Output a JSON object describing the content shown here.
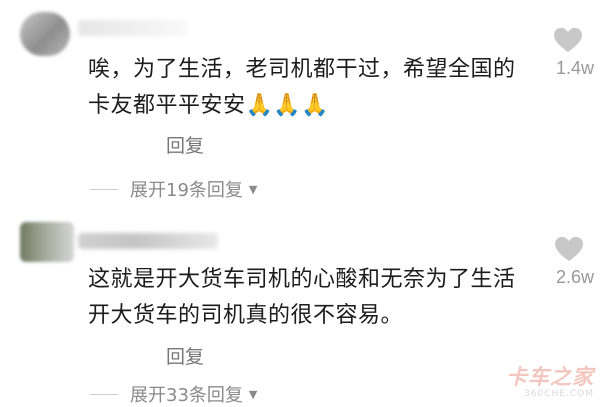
{
  "comments": [
    {
      "text": "唉，为了生活，老司机都干过，希望全国的\n卡友都平平安安🙏🙏🙏",
      "like_count": "1.4w",
      "reply_label": "回复",
      "expand_label": "展开19条回复"
    },
    {
      "text": "这就是开大货车司机的心酸和无奈为了生活\n开大货车的司机真的很不容易。",
      "like_count": "2.6w",
      "reply_label": "回复",
      "expand_label": "展开33条回复"
    }
  ],
  "icons": {
    "like": "heart-icon",
    "expand": "caret-down-icon"
  },
  "colors": {
    "like_icon": "#c8c8c8",
    "meta_text": "#8a8a8a",
    "watermark": "#f3c7bf"
  },
  "watermark": {
    "main": "卡车之家",
    "sub": "360CHE.COM"
  }
}
